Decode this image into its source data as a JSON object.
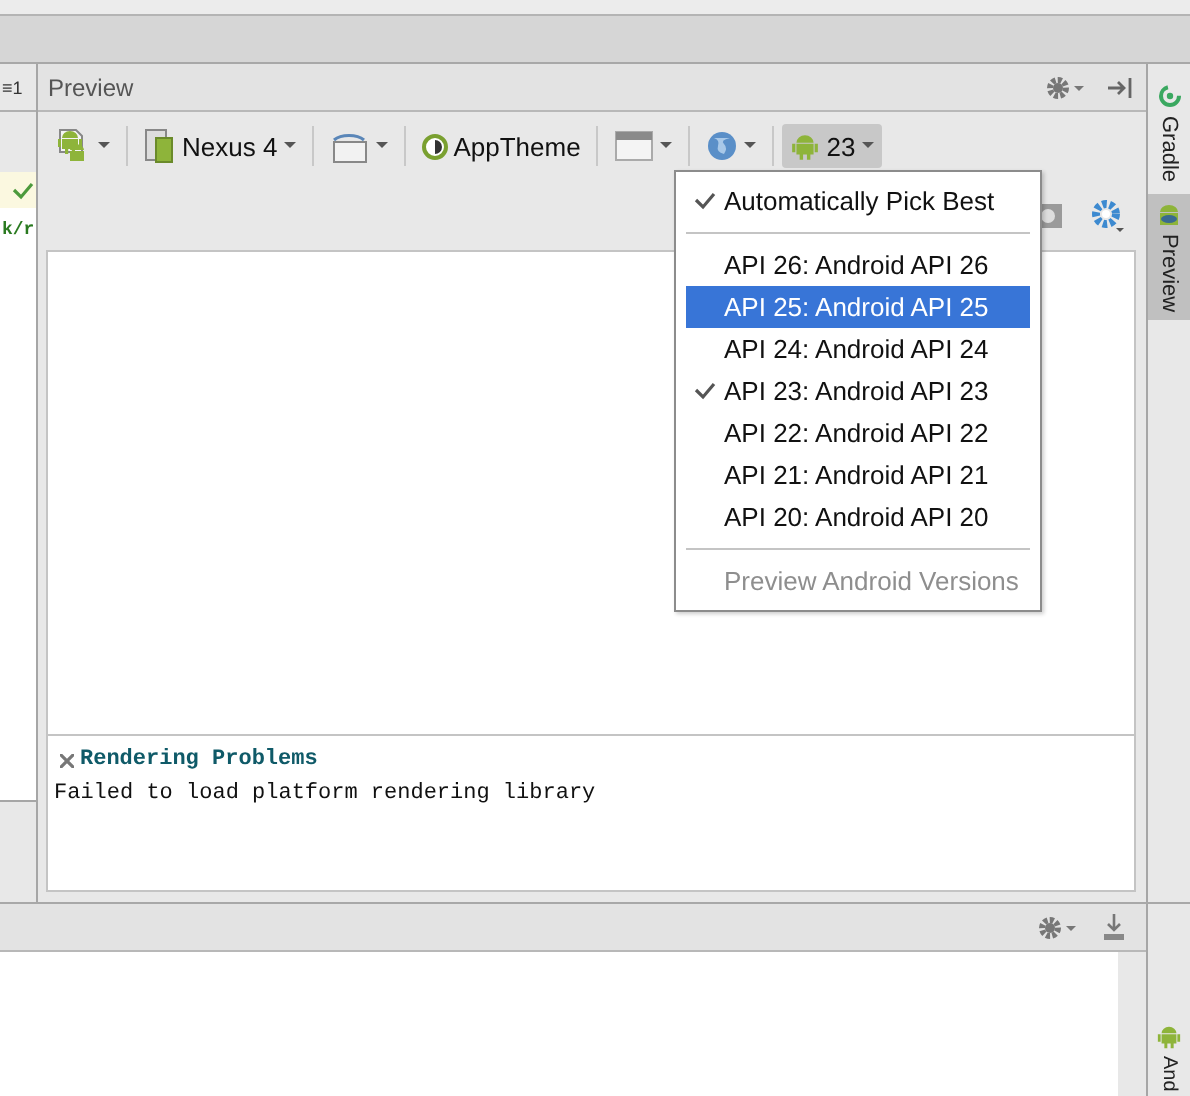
{
  "left_editor": {
    "tab_label": "≡1",
    "status_ok": true,
    "code_fragment": "k/r"
  },
  "preview": {
    "title": "Preview",
    "toolbar": [
      {
        "kind": "device-type",
        "pressed": false
      },
      {
        "kind": "device",
        "label": "Nexus 4",
        "pressed": false
      },
      {
        "kind": "orientation",
        "pressed": false
      },
      {
        "kind": "theme",
        "label": "AppTheme",
        "pressed": false
      },
      {
        "kind": "layout",
        "pressed": false
      },
      {
        "kind": "locale",
        "pressed": false
      },
      {
        "kind": "api",
        "label": "23",
        "pressed": true
      }
    ],
    "error_panel": {
      "title": "Rendering Problems",
      "message": "Failed to load platform rendering library"
    }
  },
  "api_menu": {
    "items": [
      {
        "kind": "item",
        "label": "Automatically Pick Best",
        "checked": true,
        "selected": false
      },
      {
        "kind": "separator"
      },
      {
        "kind": "item",
        "label": "API 26: Android API 26",
        "checked": false,
        "selected": false
      },
      {
        "kind": "item",
        "label": "API 25: Android API 25",
        "checked": false,
        "selected": true
      },
      {
        "kind": "item",
        "label": "API 24: Android API 24",
        "checked": false,
        "selected": false
      },
      {
        "kind": "item",
        "label": "API 23: Android API 23",
        "checked": true,
        "selected": false
      },
      {
        "kind": "item",
        "label": "API 22: Android API 22",
        "checked": false,
        "selected": false
      },
      {
        "kind": "item",
        "label": "API 21: Android API 21",
        "checked": false,
        "selected": false
      },
      {
        "kind": "item",
        "label": "API 20: Android API 20",
        "checked": false,
        "selected": false
      },
      {
        "kind": "separator"
      },
      {
        "kind": "item",
        "label": "Preview Android Versions",
        "checked": false,
        "selected": false,
        "disabled": true
      }
    ]
  },
  "side_tabs": [
    {
      "kind": "gradle",
      "label": "Gradle",
      "selected": false
    },
    {
      "kind": "preview",
      "label": "Preview",
      "selected": true
    }
  ],
  "bottom_side_tab": {
    "label": "And"
  }
}
